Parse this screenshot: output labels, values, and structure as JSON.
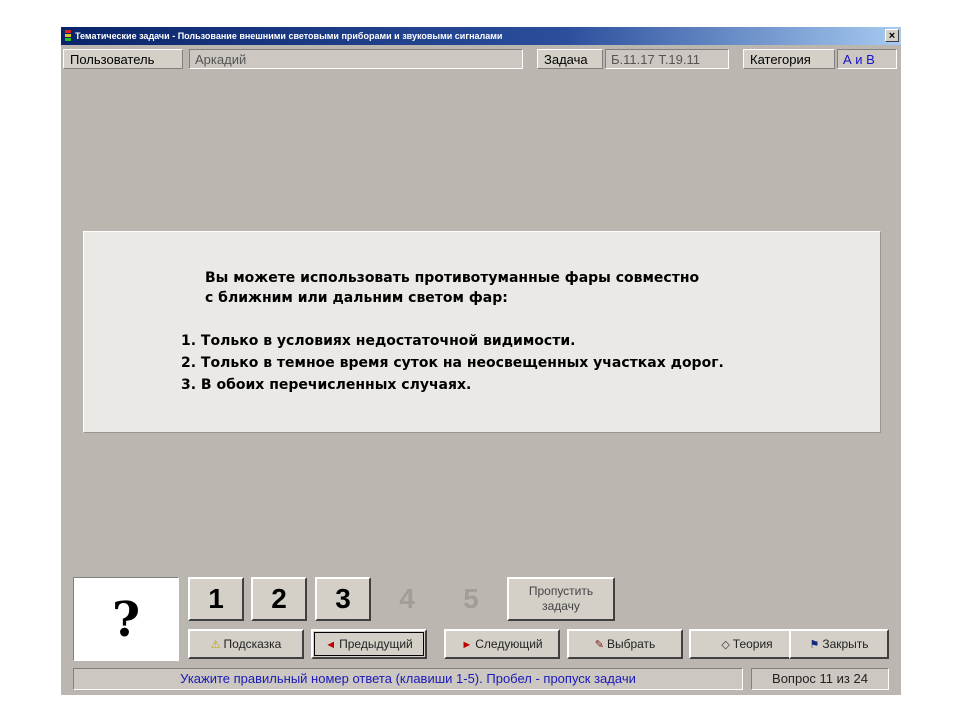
{
  "window": {
    "title": "Тематические задачи - Пользование внешними световыми приборами и звуковыми сигналами",
    "close_label": "×"
  },
  "infobar": {
    "user_label": "Пользователь",
    "user_value": "Аркадий",
    "task_label": "Задача",
    "task_value": "Б.11.17  Т.19.11",
    "category_label": "Категория",
    "category_value": "А и В"
  },
  "question": {
    "line1": "Вы можете использовать противотуманные фары совместно",
    "line2": "с ближним или дальним светом фар:",
    "answers": [
      "1. Только в условиях недостаточной видимости.",
      "2. Только в темное время суток на неосвещенных участках дорог.",
      "3. В обоих перечисленных случаях."
    ]
  },
  "answer_indicator": "?",
  "answer_buttons": [
    "1",
    "2",
    "3"
  ],
  "disabled_numbers": [
    "4",
    "5"
  ],
  "skip_button": {
    "line1": "Пропустить",
    "line2": "задачу"
  },
  "nav_buttons": [
    {
      "icon": "⚠",
      "label": "Подсказка",
      "icon_color": "#c8a000"
    },
    {
      "icon": "◄",
      "label": "Предыдущий",
      "icon_color": "#c00000"
    },
    {
      "icon": "►",
      "label": "Следующий",
      "icon_color": "#c00000"
    },
    {
      "icon": "✎",
      "label": "Выбрать",
      "icon_color": "#7a1010"
    },
    {
      "icon": "◇",
      "label": "Теория",
      "icon_color": "#333333"
    },
    {
      "icon": "⚑",
      "label": "Закрыть",
      "icon_color": "#102a80"
    }
  ],
  "statusbar": {
    "hint": "Укажите правильный номер ответа (клавиши 1-5). Пробел - пропуск задачи",
    "progress": "Вопрос 11 из 24"
  },
  "colors": {
    "title_bar": "#0a246a",
    "window_bg": "#bbb6b0",
    "accent_blue": "#1414c8"
  }
}
